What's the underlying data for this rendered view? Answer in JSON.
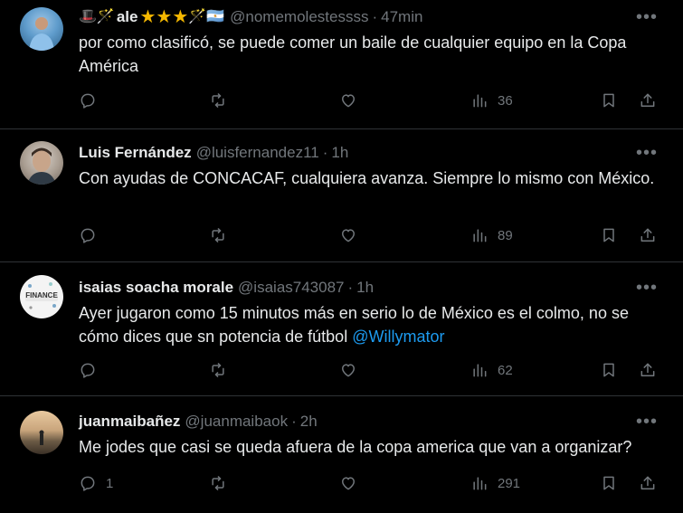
{
  "tweets": [
    {
      "name": "ale",
      "handle": "@nomemolestessss",
      "time": "47min",
      "text": "por como clasificó, se puede comer un baile de cualquier equipo en la Copa América",
      "replies": "",
      "views": "36"
    },
    {
      "name": "Luis Fernández",
      "handle": "@luisfernandez11",
      "time": "1h",
      "text": "Con ayudas de CONCACAF, cualquiera avanza. Siempre lo mismo con México.",
      "replies": "",
      "views": "89"
    },
    {
      "name": "isaias soacha morale",
      "handle": "@isaias743087",
      "time": "1h",
      "text": "Ayer jugaron como 15 minutos más en serio lo de México es el colmo, no se cómo dices que sn potencia de fútbol ",
      "mention": "@Willymator",
      "replies": "",
      "views": "62",
      "avatar_text": "FINANCE"
    },
    {
      "name": "juanmaibañez",
      "handle": "@juanmaibaok",
      "time": "2h",
      "text": "Me jodes que casi se queda afuera de la copa america que van a organizar?",
      "replies": "1",
      "views": "291"
    }
  ],
  "separator": "·",
  "more_glyph": "•••",
  "emoji_glyphs": {
    "hat": "🎩",
    "wand": "🪄",
    "star": "★",
    "flag": "🇦🇷"
  },
  "colors": {
    "background": "#000000",
    "text": "#e7e9ea",
    "muted": "#71767b",
    "link": "#1d9bf0",
    "divider": "#2f3336",
    "star": "#f5b800"
  }
}
